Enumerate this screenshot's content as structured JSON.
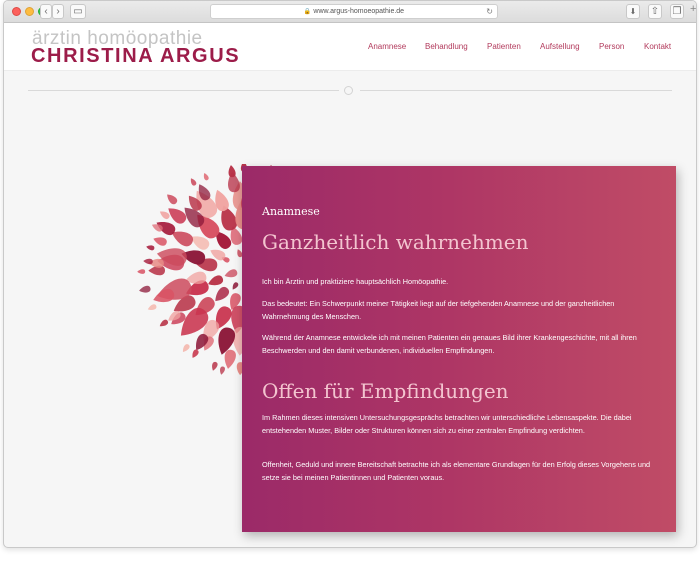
{
  "browser": {
    "url": "www.argus-homoeopathie.de",
    "icons": [
      "back-icon",
      "forward-icon",
      "sidebar-icon",
      "lock-icon",
      "reload-icon",
      "download-icon",
      "share-icon",
      "tabs-icon",
      "new-tab-icon"
    ]
  },
  "logo": {
    "subtitle": "ärztin homöopathie",
    "name": "CHRISTINA ARGUS"
  },
  "nav": {
    "items": [
      "Anamnese",
      "Behandlung",
      "Patienten",
      "Aufstellung",
      "Person",
      "Kontakt"
    ]
  },
  "colors": {
    "brand": "#9c1c49",
    "nav_text": "#b23a5c",
    "card_gradient_start": "#9b2a68",
    "card_gradient_end": "#c04c66",
    "heading_pink": "#f3c4cf"
  },
  "card": {
    "kicker": "Anamnese",
    "heading1": "Ganzheitlich wahrnehmen",
    "p1": "Ich bin Ärztin und praktiziere hauptsächlich Homöopathie.",
    "p2": "Das bedeutet: Ein Schwerpunkt meiner Tätigkeit liegt auf der tiefgehenden Anamnese und der ganzheitlichen Wahrnehmung des Menschen.",
    "p3": "Während der Anamnese entwickele ich mit meinen Patienten ein genaues Bild ihrer Krankengeschichte, mit all ihren Beschwerden und den damit verbundenen, individuellen Empfindungen.",
    "heading2": "Offen für Empfindungen",
    "p4": "Im Rahmen dieses intensiven Untersuchungsgesprächs betrachten wir unterschiedliche Lebensaspekte. Die dabei entstehenden Muster, Bilder oder Strukturen können sich zu einer zentralen Empfindung verdichten.",
    "p5": "Offenheit, Geduld und innere Bereitschaft betrachte ich als elementare Grundlagen für den Erfolg dieses Vorgehens und setze sie bei meinen Patientinnen und Patienten voraus."
  }
}
